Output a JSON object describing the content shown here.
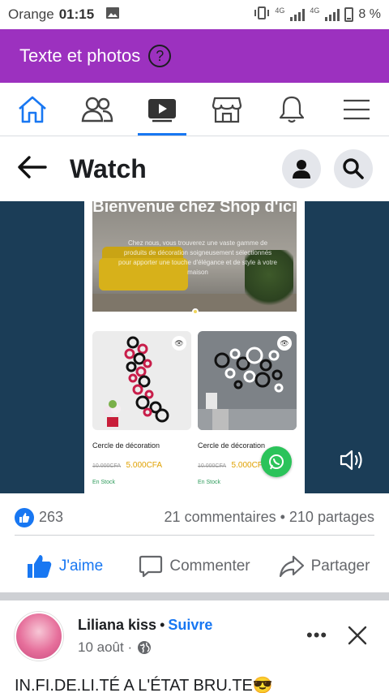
{
  "status_bar": {
    "carrier": "Orange",
    "time": "01:15",
    "network_label_1": "4G",
    "network_label_2": "4G",
    "battery": "8 %"
  },
  "banner": {
    "text": "Texte et photos",
    "help_glyph": "?"
  },
  "tabs": [
    {
      "icon": "home-icon",
      "active": false
    },
    {
      "icon": "friends-icon",
      "active": false
    },
    {
      "icon": "watch-icon",
      "active": true
    },
    {
      "icon": "marketplace-icon",
      "active": false
    },
    {
      "icon": "bell-icon",
      "active": false
    },
    {
      "icon": "menu-icon",
      "active": false
    }
  ],
  "header": {
    "title": "Watch"
  },
  "video": {
    "hero_title": "Bienvenue chez Shop d'ici",
    "hero_text": "Chez nous, vous trouverez une vaste gamme de produits de décoration soigneusement sélectionnés pour apporter une touche d'élégance et de style à votre maison",
    "products": [
      {
        "name": "Cercle de décoration",
        "old_price": "10.000CFA",
        "new_price": "5.000CFA",
        "stock": "En Stock"
      },
      {
        "name": "Cercle de décoration",
        "old_price": "10.000CFA",
        "new_price": "5.000CFA",
        "stock": "En Stock"
      }
    ]
  },
  "stats": {
    "likes": "263",
    "comments_shares": "21 commentaires • 210 partages"
  },
  "actions": {
    "like": "J'aime",
    "comment": "Commenter",
    "share": "Partager"
  },
  "post": {
    "author": "Liliana kiss",
    "separator": "•",
    "follow": "Suivre",
    "date": "10 août ·",
    "more": "•••",
    "text": "IN.FI.DE.LI.TÉ A L'ÉTAT BRU.TE😎"
  },
  "colors": {
    "banner": "#9c31bf",
    "accent": "#1877f2",
    "video_bg": "#1b3d57",
    "whatsapp": "#2bc35a"
  }
}
